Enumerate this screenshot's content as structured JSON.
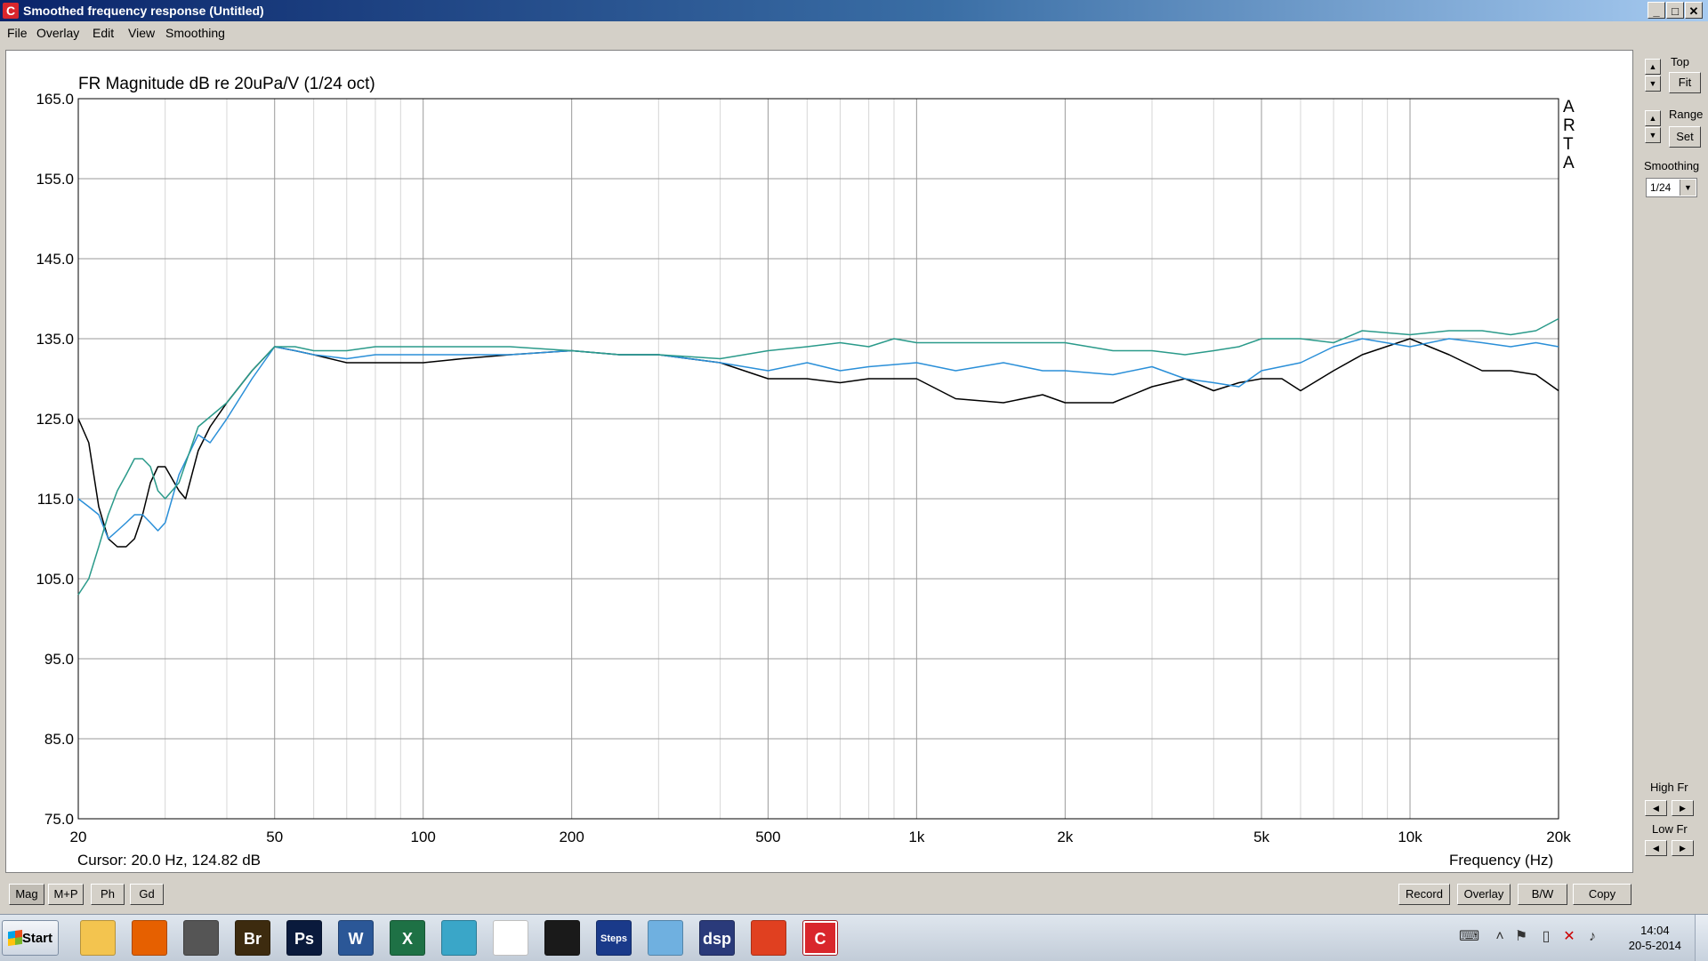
{
  "window": {
    "title": "Smoothed frequency response (Untitled)",
    "app_icon": "arta-c-icon",
    "controls": [
      "_",
      "□",
      "✕"
    ]
  },
  "menu": [
    "File",
    "Overlay",
    "Edit",
    "View",
    "Smoothing"
  ],
  "plot": {
    "arta_letters": [
      "A",
      "R",
      "T",
      "A"
    ],
    "cursor_text": "Cursor: 20.0 Hz, 124.82 dB",
    "frequency_label": "Frequency (Hz)"
  },
  "chart_data": {
    "type": "line",
    "title": "FR Magnitude dB re 20uPa/V (1/24 oct)",
    "xlabel": "Frequency (Hz)",
    "ylabel": "",
    "x_scale": "log",
    "xlim": [
      20,
      20000
    ],
    "ylim": [
      75,
      165
    ],
    "grid": true,
    "xticks": [
      20,
      50,
      100,
      200,
      500,
      1000,
      2000,
      5000,
      10000,
      20000
    ],
    "xtick_labels": [
      "20",
      "50",
      "100",
      "200",
      "500",
      "1k",
      "2k",
      "5k",
      "10k",
      "20k"
    ],
    "yticks": [
      165,
      155,
      145,
      135,
      125,
      115,
      105,
      95,
      85,
      75
    ],
    "ytick_labels": [
      "165.0",
      "155.0",
      "145.0",
      "135.0",
      "125.0",
      "115.0",
      "105.0",
      "95.0",
      "85.0",
      "75.0"
    ],
    "colors": [
      "#000000",
      "#2a8fd8",
      "#2a9a8a"
    ],
    "series": [
      {
        "x": [
          20,
          21,
          22,
          23,
          24,
          25,
          26,
          27,
          28,
          29,
          30,
          32,
          33,
          35,
          37,
          40,
          45,
          50,
          55,
          60,
          70,
          80,
          100,
          120,
          150,
          200,
          250,
          300,
          400,
          500,
          600,
          700,
          800,
          1000,
          1200,
          1500,
          1800,
          2000,
          2500,
          3000,
          3500,
          4000,
          4500,
          5000,
          5500,
          6000,
          7000,
          8000,
          10000,
          12000,
          14000,
          16000,
          18000,
          20000
        ],
        "y": [
          125,
          122,
          114,
          110,
          109,
          109,
          110,
          113,
          117,
          119,
          119,
          116,
          115,
          121,
          124,
          127,
          131,
          134,
          133.5,
          133,
          132,
          132,
          132,
          132.5,
          133,
          133.5,
          133,
          133,
          132,
          130,
          130,
          129.5,
          130,
          130,
          127.5,
          127,
          128,
          127,
          127,
          129,
          130,
          128.5,
          129.5,
          130,
          130,
          128.5,
          131,
          133,
          135,
          133,
          131,
          131,
          130.5,
          128.5
        ]
      },
      {
        "x": [
          20,
          21,
          22,
          23,
          24,
          25,
          26,
          27,
          28,
          29,
          30,
          32,
          35,
          37,
          40,
          45,
          50,
          55,
          60,
          70,
          80,
          100,
          120,
          150,
          200,
          250,
          300,
          400,
          500,
          600,
          700,
          800,
          1000,
          1200,
          1500,
          1800,
          2000,
          2500,
          3000,
          3500,
          4000,
          4500,
          5000,
          6000,
          7000,
          8000,
          10000,
          12000,
          14000,
          16000,
          18000,
          20000
        ],
        "y": [
          115,
          114,
          113,
          110,
          111,
          112,
          113,
          113,
          112,
          111,
          112,
          118,
          123,
          122,
          125,
          130,
          134,
          133.5,
          133,
          132.5,
          133,
          133,
          133,
          133,
          133.5,
          133,
          133,
          132,
          131,
          132,
          131,
          131.5,
          132,
          131,
          132,
          131,
          131,
          130.5,
          131.5,
          130,
          129.5,
          129,
          131,
          132,
          134,
          135,
          134,
          135,
          134.5,
          134,
          134.5,
          134
        ]
      },
      {
        "x": [
          20,
          21,
          22,
          23,
          24,
          25,
          26,
          27,
          28,
          29,
          30,
          32,
          35,
          40,
          45,
          50,
          55,
          60,
          70,
          80,
          100,
          120,
          150,
          200,
          250,
          300,
          400,
          500,
          600,
          700,
          800,
          900,
          1000,
          1200,
          1500,
          1800,
          2000,
          2500,
          3000,
          3500,
          4000,
          4500,
          5000,
          6000,
          7000,
          8000,
          10000,
          12000,
          14000,
          16000,
          18000,
          20000
        ],
        "y": [
          103,
          105,
          109,
          113,
          116,
          118,
          120,
          120,
          119,
          116,
          115,
          117,
          124,
          127,
          131,
          134,
          134,
          133.5,
          133.5,
          134,
          134,
          134,
          134,
          133.5,
          133,
          133,
          132.5,
          133.5,
          134,
          134.5,
          134,
          135,
          134.5,
          134.5,
          134.5,
          134.5,
          134.5,
          133.5,
          133.5,
          133,
          133.5,
          134,
          135,
          135,
          134.5,
          136,
          135.5,
          136,
          136,
          135.5,
          136,
          137.5
        ]
      }
    ]
  },
  "right_panel": {
    "top_label": "Top",
    "fit_button": "Fit",
    "range_label": "Range",
    "set_button": "Set",
    "smoothing_label": "Smoothing",
    "smoothing_value": "1/24",
    "high_fr_label": "High Fr",
    "low_fr_label": "Low Fr"
  },
  "bottom_buttons": {
    "left": [
      "Mag",
      "M+P",
      "Ph",
      "Gd"
    ],
    "right": [
      "Record",
      "Overlay",
      "B/W",
      "Copy"
    ]
  },
  "taskbar": {
    "start_label": "Start",
    "apps": [
      {
        "name": "explorer-icon",
        "text": "",
        "color": "#f3c44f"
      },
      {
        "name": "firefox-icon",
        "text": "",
        "color": "#e66000"
      },
      {
        "name": "camera-app-icon",
        "text": "",
        "color": "#555555"
      },
      {
        "name": "bridge-icon",
        "text": "Br",
        "color": "#3d2b0f"
      },
      {
        "name": "photoshop-icon",
        "text": "Ps",
        "color": "#0a1a3c"
      },
      {
        "name": "word-icon",
        "text": "W",
        "color": "#2b5797"
      },
      {
        "name": "excel-icon",
        "text": "X",
        "color": "#1e7145"
      },
      {
        "name": "calculator-app-icon",
        "text": "",
        "color": "#3aa6c8"
      },
      {
        "name": "limp-icon",
        "text": "",
        "color": "#ffffff"
      },
      {
        "name": "oscilloscope-icon",
        "text": "",
        "color": "#1a1a1a"
      },
      {
        "name": "steps-icon",
        "text": "Steps",
        "color": "#1a3a8a"
      },
      {
        "name": "network-app-icon",
        "text": "",
        "color": "#6fb0e0"
      },
      {
        "name": "dsp-icon",
        "text": "dsp",
        "color": "#2a3a7a"
      },
      {
        "name": "office-icon",
        "text": "",
        "color": "#e04020"
      },
      {
        "name": "arta-icon",
        "text": "C",
        "color": "#d9262c"
      }
    ],
    "clock_time": "14:04",
    "clock_date": "20-5-2014"
  }
}
